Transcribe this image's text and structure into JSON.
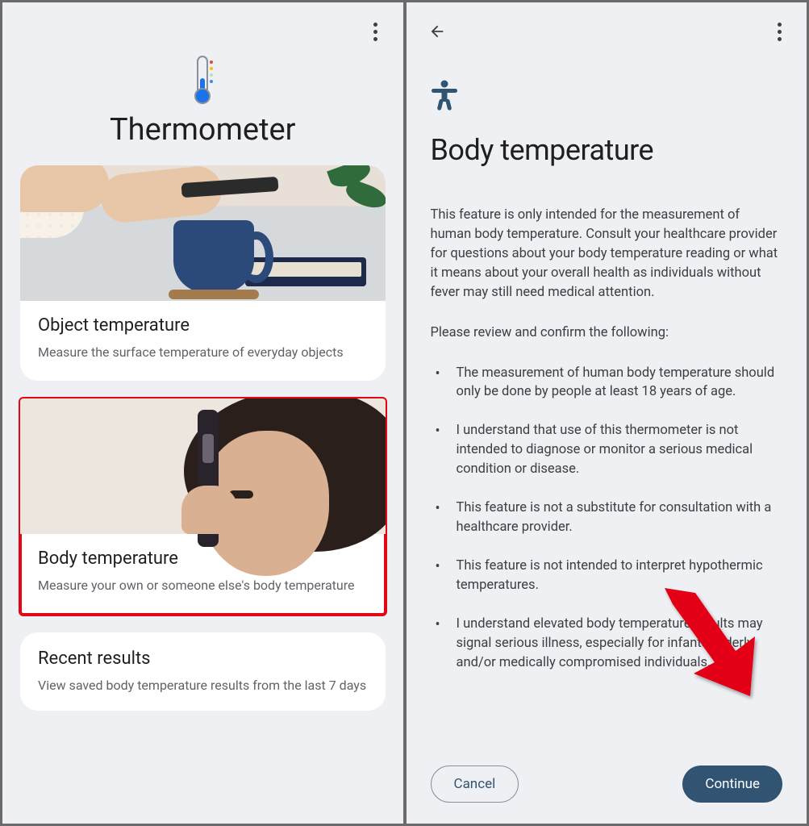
{
  "screen1": {
    "title": "Thermometer",
    "cards": [
      {
        "title": "Object temperature",
        "subtitle": "Measure the surface temperature of everyday objects"
      },
      {
        "title": "Body temperature",
        "subtitle": "Measure your own or someone else's body temperature"
      }
    ],
    "recent": {
      "title": "Recent results",
      "subtitle": "View saved body temperature results from the last 7 days"
    }
  },
  "screen2": {
    "title": "Body temperature",
    "intro": "This feature is only intended for the measurement of human body temperature. Consult your healthcare provider for questions about your body temperature reading or what it means about your overall health as individuals without fever may still need medical attention.",
    "review_prompt": "Please review and confirm the following:",
    "bullets": [
      "The measurement of human body temperature should only be done by people at least 18 years of age.",
      "I understand that use of this thermometer is not intended to diagnose or monitor a serious medical condition or disease.",
      "This feature is not a substitute for consultation with a healthcare provider.",
      "This feature is not intended to interpret hypothermic temperatures.",
      "I understand elevated body temperature results may signal serious illness, especially for infants, elderly and/or medically compromised individuals."
    ],
    "cancel": "Cancel",
    "continue": "Continue"
  }
}
